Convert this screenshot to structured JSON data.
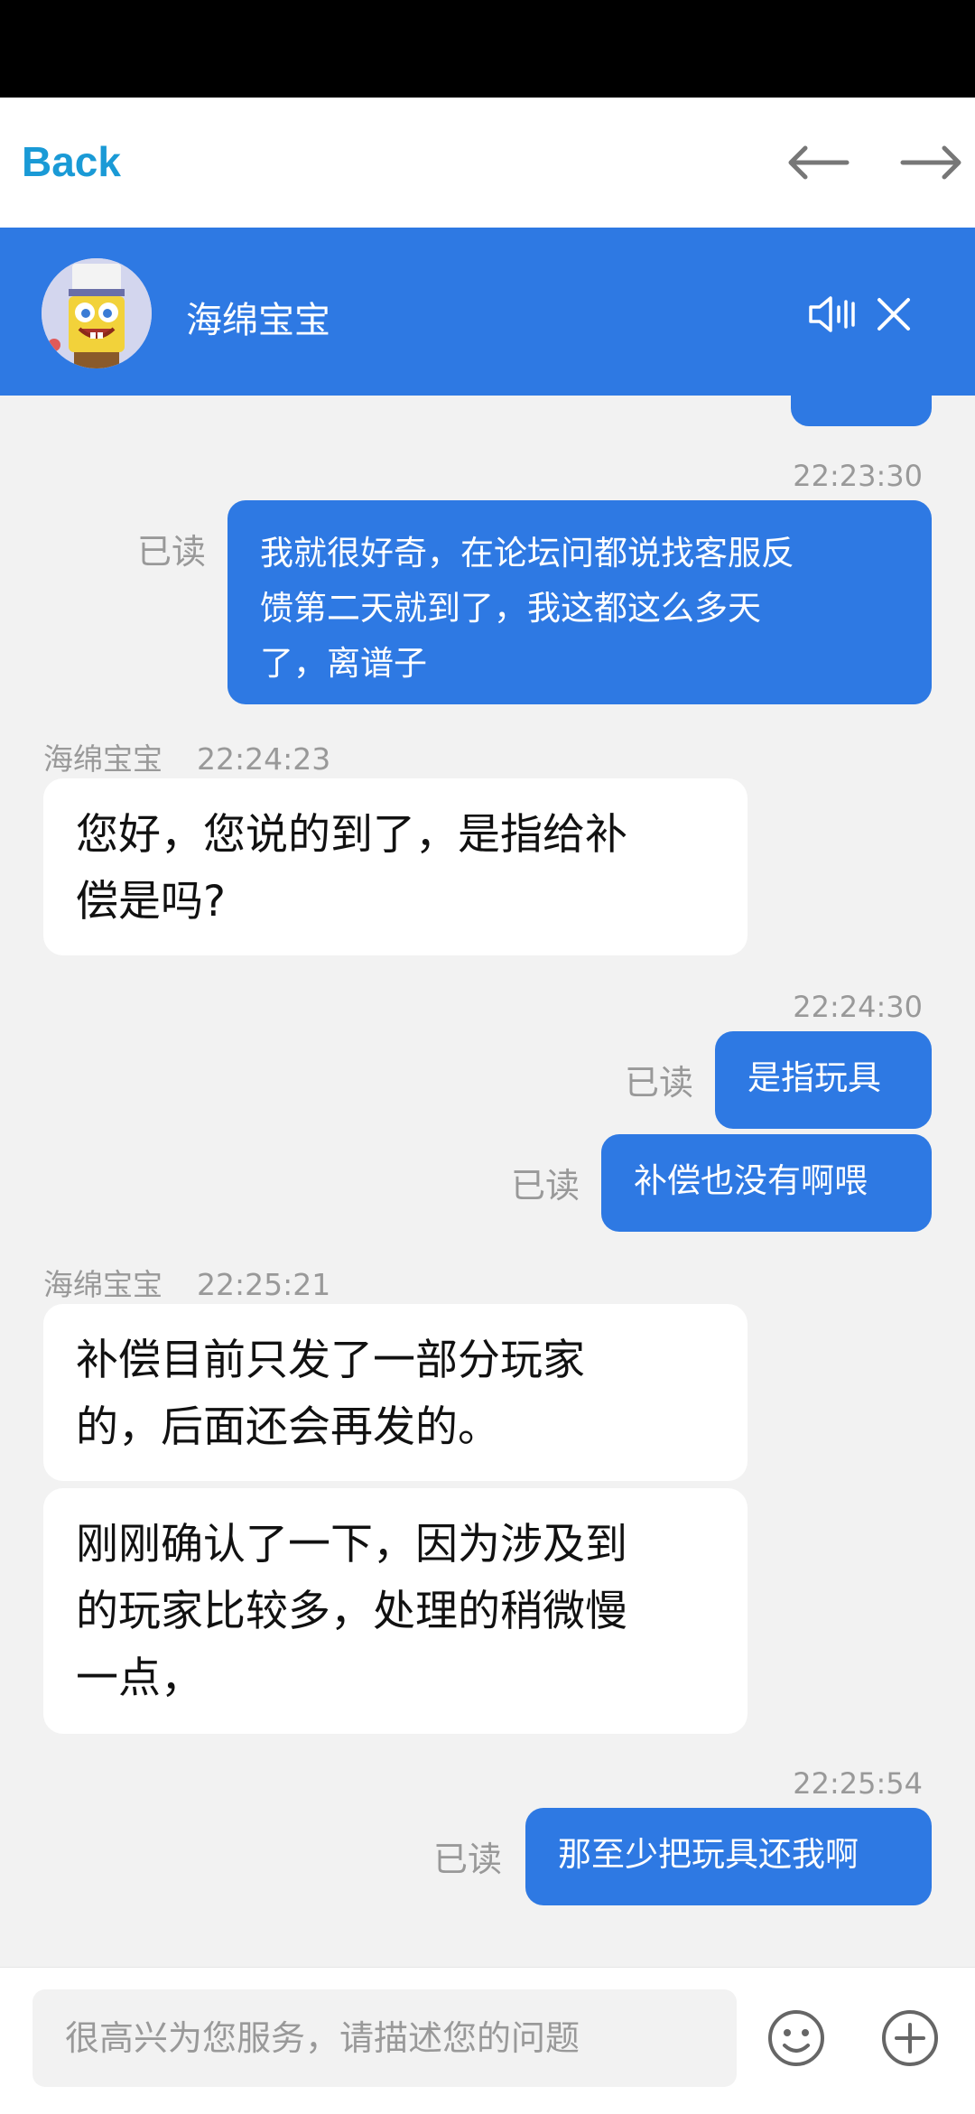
{
  "nav": {
    "back_label": "Back"
  },
  "header": {
    "agent_name": "海绵宝宝"
  },
  "messages": [
    {
      "time": "22:23:30",
      "read": "已读",
      "lines": [
        "我就很好奇，在论坛问都说找客服反",
        "馈第二天就到了，我这都这么多天",
        "了，离谱子"
      ]
    },
    {
      "sender": "海绵宝宝",
      "time": "22:24:23",
      "lines": [
        "您好，您说的到了，是指给补",
        "偿是吗?"
      ]
    },
    {
      "time": "22:24:30",
      "read": "已读",
      "text": "是指玩具"
    },
    {
      "read": "已读",
      "text": "补偿也没有啊喂"
    },
    {
      "sender": "海绵宝宝",
      "time": "22:25:21",
      "lines": [
        "补偿目前只发了一部分玩家",
        "的，后面还会再发的。"
      ]
    },
    {
      "lines": [
        "刚刚确认了一下，因为涉及到",
        "的玩家比较多，处理的稍微慢",
        "一点，"
      ]
    },
    {
      "time": "22:25:54",
      "read": "已读",
      "text": "那至少把玩具还我啊"
    }
  ],
  "input": {
    "placeholder": "很高兴为您服务，请描述您的问题"
  }
}
